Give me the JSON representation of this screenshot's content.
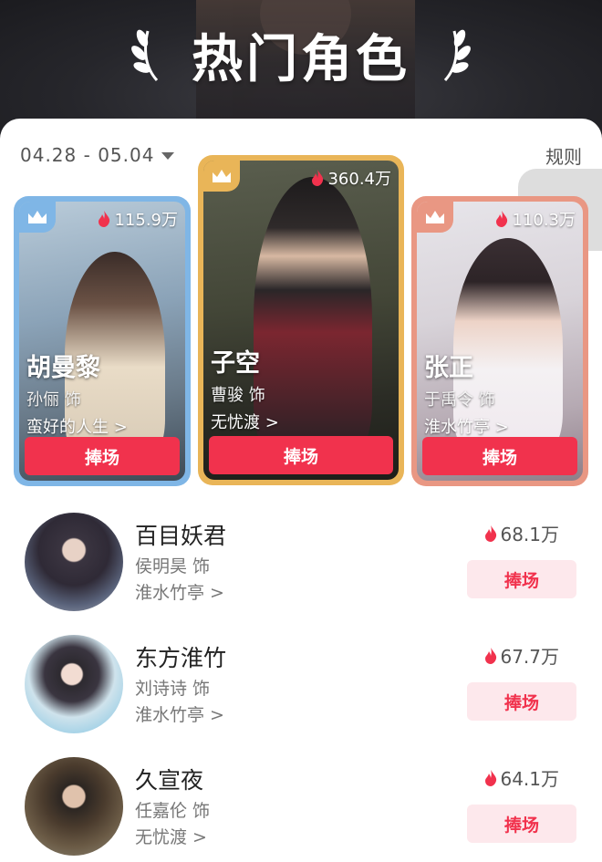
{
  "header": {
    "title": "热门角色"
  },
  "filter": {
    "date_range": "04.28 - 05.04",
    "rules_label": "规则"
  },
  "top_cards": [
    {
      "role": "胡曼黎",
      "actor": "孙俪 饰",
      "drama": "蛮好的人生 >",
      "heat": "115.9万",
      "button": "捧场"
    },
    {
      "role": "子空",
      "actor": "曹骏 饰",
      "drama": "无忧渡 >",
      "heat": "360.4万",
      "button": "捧场"
    },
    {
      "role": "张正",
      "actor": "于禹令 饰",
      "drama": "淮水竹亭 >",
      "heat": "110.3万",
      "button": "捧场"
    }
  ],
  "list": [
    {
      "role": "百目妖君",
      "actor": "侯明昊 饰",
      "drama": "淮水竹亭 >",
      "heat": "68.1万",
      "button": "捧场"
    },
    {
      "role": "东方淮竹",
      "actor": "刘诗诗 饰",
      "drama": "淮水竹亭 >",
      "heat": "67.7万",
      "button": "捧场"
    },
    {
      "role": "久宣夜",
      "actor": "任嘉伦 饰",
      "drama": "无忧渡 >",
      "heat": "64.1万",
      "button": "捧场"
    }
  ],
  "colors": {
    "accent": "#f1324d",
    "accent_soft": "#fde8ec",
    "rank1_frame": "#e9b558",
    "rank2_frame": "#7fb6e6",
    "rank3_frame": "#e99783"
  },
  "icons": [
    "laurel-left-icon",
    "laurel-right-icon",
    "caret-down-icon",
    "crown-icon",
    "flame-icon"
  ]
}
